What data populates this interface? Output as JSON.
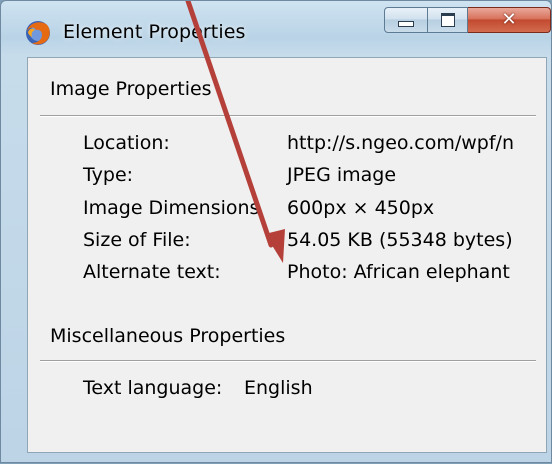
{
  "window": {
    "title": "Element Properties",
    "icon": "firefox-icon",
    "close_glyph": "✕"
  },
  "image_properties": {
    "heading": "Image Properties",
    "rows": [
      {
        "label": "Location:",
        "value": "http://s.ngeo.com/wpf/n"
      },
      {
        "label": "Type:",
        "value": "JPEG image"
      },
      {
        "label": "Image Dimensions",
        "value": "600px × 450px"
      },
      {
        "label": "Size of File:",
        "value": "54.05 KB (55348 bytes)"
      },
      {
        "label": "Alternate text:",
        "value": "Photo: African elephant"
      }
    ]
  },
  "misc_properties": {
    "heading": "Miscellaneous Properties",
    "rows": [
      {
        "label": "Text language:",
        "value": "English"
      }
    ]
  },
  "colors": {
    "annotation_arrow": "#b5403a"
  }
}
